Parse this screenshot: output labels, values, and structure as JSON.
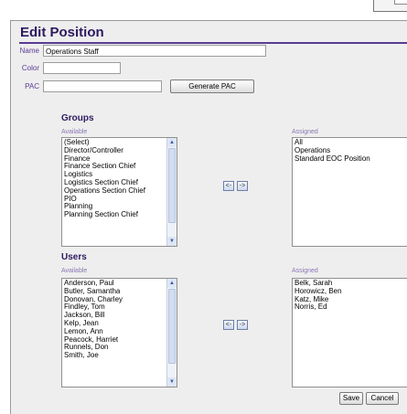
{
  "form": {
    "title": "Edit Position",
    "name_label": "Name",
    "name_value": "Operations Staff",
    "color_label": "Color",
    "color_value": "",
    "pac_label": "PAC",
    "pac_value": "",
    "generate_pac_label": "Generate PAC"
  },
  "groups": {
    "heading": "Groups",
    "available_label": "Available",
    "assigned_label": "Assigned",
    "available": [
      "(Select)",
      "Director/Controller",
      "Finance",
      "Finance Section Chief",
      "Logistics",
      "Logistics Section Chief",
      "Operations Section Chief",
      "PIO",
      "Planning",
      "Planning Section Chief"
    ],
    "assigned": [
      "All",
      "Operations",
      "Standard EOC Position"
    ],
    "move_left": "<-",
    "move_right": "->"
  },
  "users": {
    "heading": "Users",
    "available_label": "Available",
    "assigned_label": "Assigned",
    "available": [
      "Anderson, Paul",
      "Butler, Samantha",
      "Donovan, Charley",
      "Findley, Tom",
      "Jackson, Bill",
      "Kelp, Jean",
      "Lemon, Ann",
      "Peacock, Harriet",
      "Runnels, Don",
      "Smith, Joe"
    ],
    "assigned": [
      "Belk, Sarah",
      "Horowicz, Ben",
      "Katz, Mike",
      "Norris, Ed"
    ],
    "move_left": "<-",
    "move_right": "->"
  },
  "actions": {
    "save_label": "Save",
    "cancel_label": "Cancel"
  },
  "icons": {
    "scroll_up": "chevron-up-icon",
    "scroll_down": "chevron-down-icon"
  }
}
